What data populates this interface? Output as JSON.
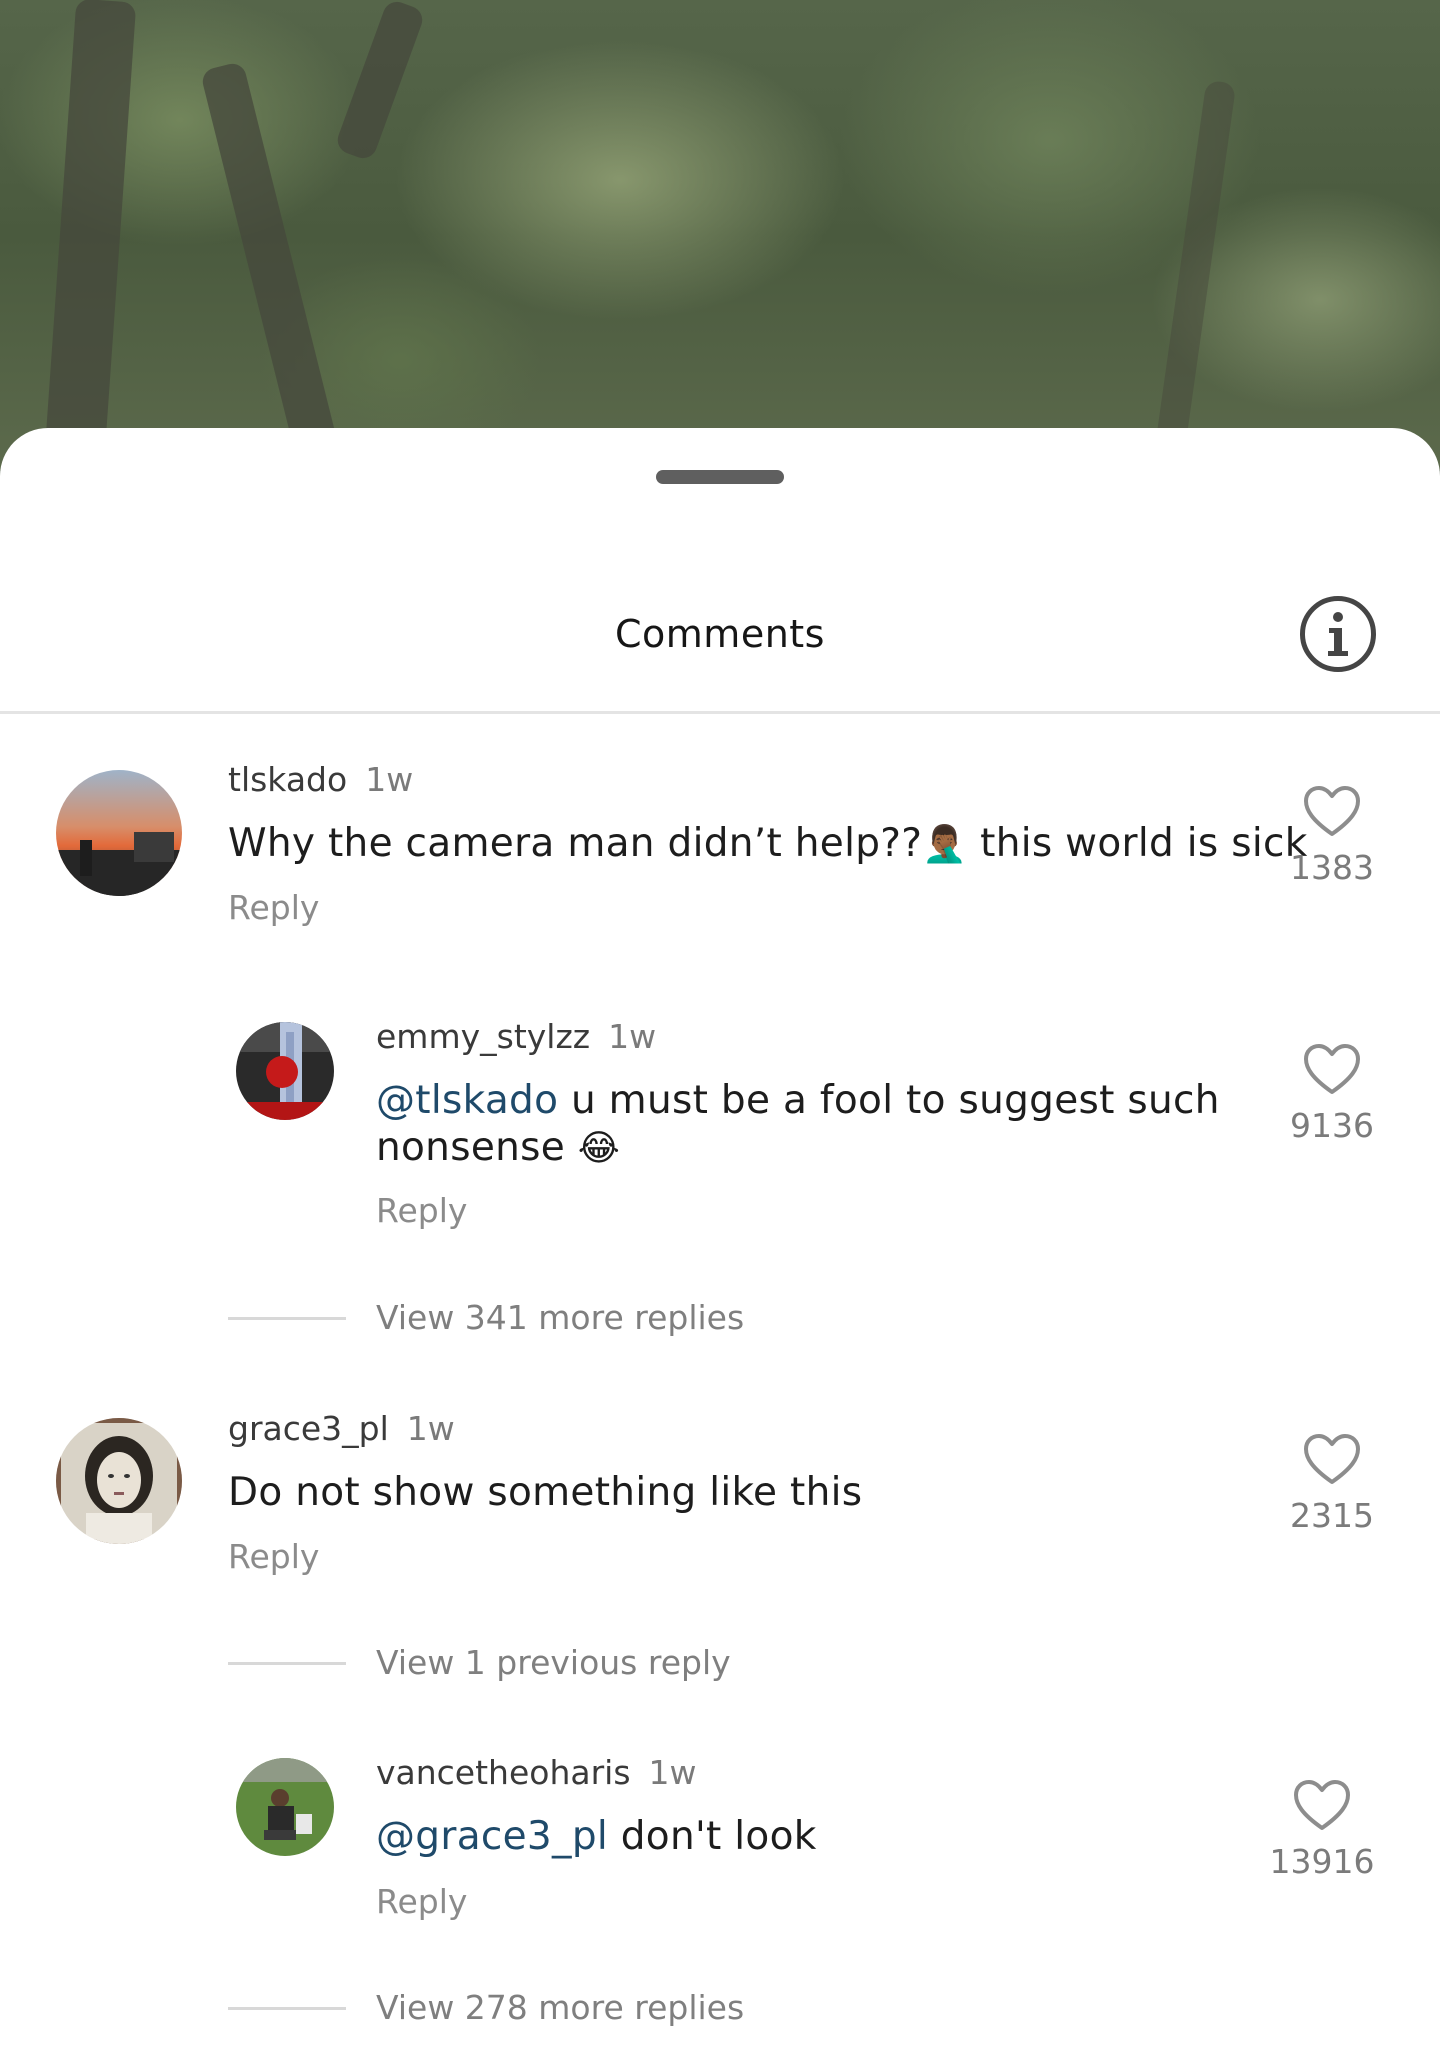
{
  "sheet": {
    "title": "Comments",
    "info_icon": "info-icon"
  },
  "comments": [
    {
      "username": "tlskado",
      "time": "1w",
      "text_before": "Why the camera man didn’t help??",
      "emoji": "🤦🏾‍♂️",
      "text_after": " this world is sick",
      "reply_label": "Reply",
      "likes": "1383"
    },
    {
      "username": "emmy_stylzz",
      "time": "1w",
      "mention": "@tlskado",
      "text_line1": " u must be a fool to suggest such",
      "text_line2": "nonsense",
      "emoji": "😂",
      "reply_label": "Reply",
      "likes": "9136"
    },
    {
      "username": "grace3_pl",
      "time": "1w",
      "text": "Do not show something like this",
      "reply_label": "Reply",
      "likes": "2315"
    },
    {
      "username": "vancetheoharis",
      "time": "1w",
      "mention": "@grace3_pl",
      "text": " don't look",
      "reply_label": "Reply",
      "likes": "13916"
    }
  ],
  "view_more": {
    "first": "View 341 more replies",
    "previous": "View 1 previous reply",
    "second": "View 278 more replies"
  },
  "colors": {
    "mention": "#1f4a6a",
    "muted": "#8b8b8b",
    "text": "#1d1d1d"
  }
}
